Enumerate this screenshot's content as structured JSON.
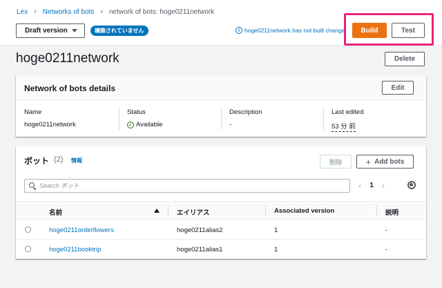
{
  "breadcrumb": {
    "items": [
      "Lex",
      "Networks of bots",
      "network of bots: hoge0211network"
    ]
  },
  "header": {
    "version_select": "Draft version",
    "unbuilt_badge": "構築されていません",
    "info_text": "hoge0211network has not built change",
    "info_icon": "info-circle-icon",
    "build_label": "Build",
    "test_label": "Test",
    "highlight_color": "#e8237a"
  },
  "page": {
    "title": "hoge0211network",
    "delete_label": "Delete"
  },
  "details": {
    "title": "Network of bots details",
    "edit_label": "Edit",
    "fields": [
      {
        "label": "Name",
        "value": "hoge0211network"
      },
      {
        "label": "Status",
        "value": "Available"
      },
      {
        "label": "Description",
        "value": "-"
      },
      {
        "label": "Last edited",
        "value": "53 分 前"
      }
    ]
  },
  "bots": {
    "title": "ボット",
    "count": "(2)",
    "info_link": "情報",
    "remove_label": "削除",
    "add_label": "Add bots",
    "search_placeholder": "Search ボット",
    "page_number": "1",
    "columns": [
      "名前",
      "エイリアス",
      "Associated version",
      "説明"
    ],
    "rows": [
      {
        "name": "hoge0211orderflowers",
        "alias": "hoge0211alias2",
        "version": "1",
        "description": "-"
      },
      {
        "name": "hoge0211booktrip",
        "alias": "hoge0211alias1",
        "version": "1",
        "description": "-"
      }
    ]
  },
  "colors": {
    "primary": "#ec7211",
    "link": "#0073bb",
    "success": "#1d8102"
  }
}
